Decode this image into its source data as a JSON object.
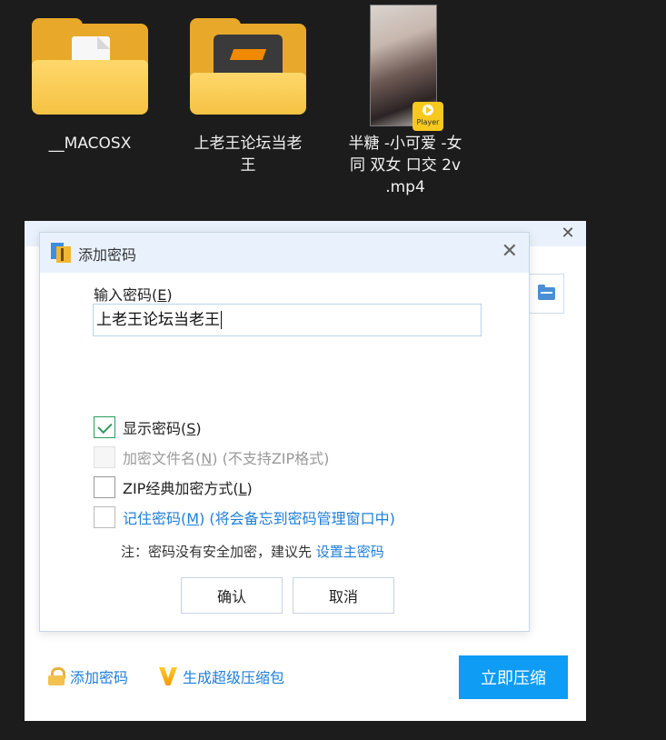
{
  "desktop": {
    "items": [
      {
        "label_lines": [
          "__MACOSX"
        ]
      },
      {
        "label_lines": [
          "上老王论坛当老",
          "王"
        ]
      },
      {
        "label_lines": [
          "半糖 -小可爱 -女",
          "同 双女 口交 2v",
          ".mp4"
        ],
        "badge": "Player"
      }
    ]
  },
  "main_window": {
    "footer": {
      "add_password": "添加密码",
      "super_pack": "生成超级压缩包",
      "compress_now": "立即压缩"
    },
    "stray_char": "Ⅱ"
  },
  "dialog": {
    "title": "添加密码",
    "password_label": "输入密码",
    "password_hotkey": "E",
    "password_value": "上老王论坛当老王",
    "options": [
      {
        "label": "显示密码",
        "hotkey": "S",
        "suffix": "",
        "checked": true,
        "state": "normal"
      },
      {
        "label": "加密文件名",
        "hotkey": "N",
        "suffix": " (不支持ZIP格式)",
        "checked": false,
        "state": "disabled"
      },
      {
        "label": "ZIP经典加密方式",
        "hotkey": "L",
        "suffix": "",
        "checked": false,
        "state": "normal"
      },
      {
        "label": "记住密码",
        "hotkey": "M",
        "suffix": " (将会备忘到密码管理窗口中)",
        "checked": false,
        "state": "link"
      }
    ],
    "note_prefix": "注：密码没有安全加密，建议先",
    "note_link": "设置主密码",
    "confirm": "确认",
    "cancel": "取消"
  },
  "colors": {
    "accent": "#0e9cf5",
    "link": "#1e7fd8",
    "check": "#2a9d5b",
    "title_bar": "#e9f2fc"
  }
}
